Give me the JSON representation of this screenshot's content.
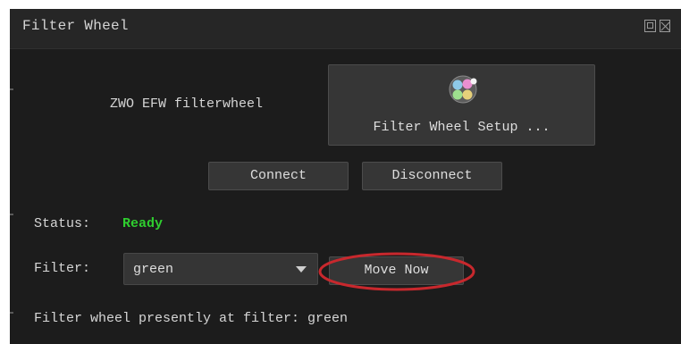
{
  "window": {
    "title": "Filter Wheel",
    "float_icon": "float-window-icon",
    "close_icon": "close-window-icon"
  },
  "device": {
    "name": "ZWO EFW filterwheel",
    "setup_label": "Filter Wheel Setup ...",
    "setup_icon": "filter-wheel-icon"
  },
  "connection": {
    "connect_label": "Connect",
    "disconnect_label": "Disconnect"
  },
  "status": {
    "label": "Status:",
    "value": "Ready",
    "value_color": "#2fcf2f"
  },
  "filter": {
    "label": "Filter:",
    "selected": "green",
    "move_label": "Move Now"
  },
  "footer": {
    "message": "Filter wheel presently at filter: green"
  },
  "annotation": {
    "highlight_color": "#c8282d"
  }
}
